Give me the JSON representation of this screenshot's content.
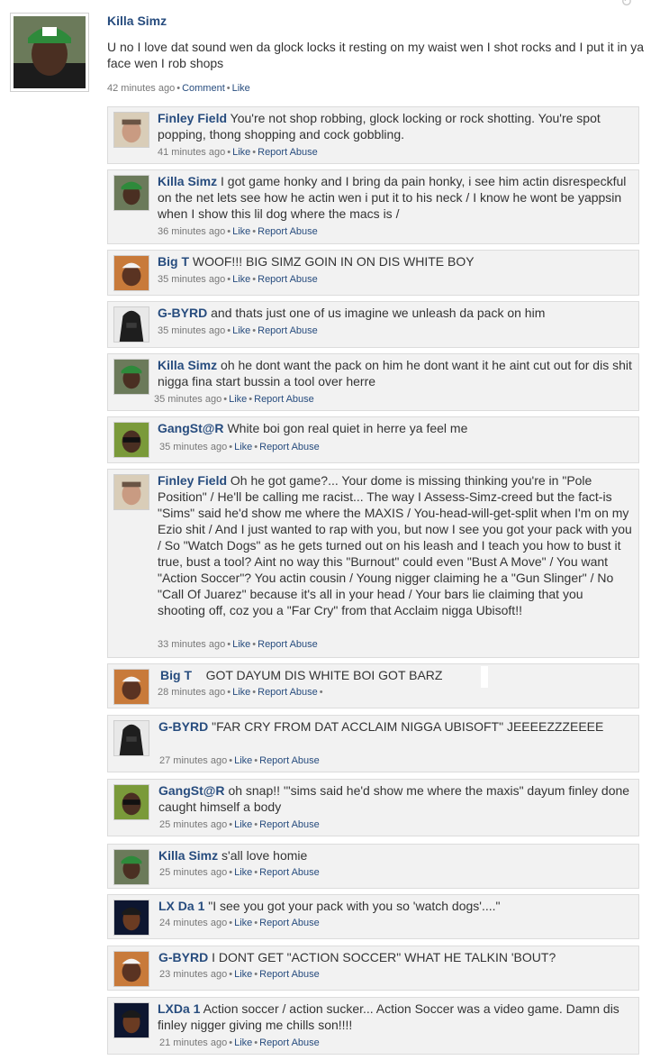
{
  "post": {
    "author": "Killa Simz",
    "text": "U no I love dat sound wen da glock locks  it resting on my waist wen I shot rocks and I put it in ya face wen I rob shops",
    "time": "42 minutes ago",
    "comment_label": "Comment",
    "like_label": "Like"
  },
  "actions": {
    "like": "Like",
    "report": "Report Abuse"
  },
  "comments": [
    {
      "author": "Finley Field",
      "avatar": "finley-avatar",
      "text": "You're not shop robbing, glock locking or rock shotting. You're spot popping, thong shopping and cock gobbling.",
      "time": "41 minutes ago"
    },
    {
      "author": "Killa Simz",
      "avatar": "killa-avatar",
      "text": "I got game honky and I bring da pain honky, i see him actin disrespeckful on the net lets see how he actin wen i put it to his neck / I know he wont be yappsin when I show this lil dog where the macs is /",
      "time": "36 minutes ago"
    },
    {
      "author": "Big T",
      "avatar": "bigt-avatar",
      "text": "WOOF!!! BIG SIMZ GOIN IN ON DIS WHITE BOY",
      "time": "35 minutes ago"
    },
    {
      "author": "G-BYRD",
      "avatar": "gbyrd-avatar",
      "text": "and thats just one of us imagine we unleash da pack on him",
      "time": "35 minutes ago"
    },
    {
      "author": "Killa Simz",
      "avatar": "killa-avatar",
      "text": "oh he dont want the pack on him he dont want it he aint cut out for dis shit nigga fina start bussin a tool over herre",
      "time": "35 minutes ago"
    },
    {
      "author": "GangSt@R",
      "avatar": "gangstar-avatar",
      "text": "White boi gon real quiet in herre ya feel me",
      "time": "35 minutes ago"
    },
    {
      "author": "Finley Field",
      "avatar": "finley-avatar",
      "text": "Oh he got game?... Your dome is missing thinking you're in \"Pole Position\" / He'll be calling me racist... The way I Assess-Simz-creed but the fact-is \"Sims\" said he'd show me where the MAXIS / You-head-will-get-split when I'm on my Ezio shit / And I just wanted to rap with you, but now I see you got your pack with you / So \"Watch Dogs\" as he gets turned out on his leash and I teach you how to bust it true, bust a tool? Aint no way this \"Burnout\" could even \"Bust A Move\" / You want \"Action Soccer\"? You actin cousin / Young nigger claiming he a \"Gun Slinger\" / No \"Call Of Juarez\" because it's all in your head / Your bars lie claiming that you shooting off, coz you a \"Far Cry\" from that Acclaim nigga Ubisoft!!",
      "time": "33 minutes ago"
    },
    {
      "author": "Big T",
      "avatar": "bigt-avatar",
      "text": "GOT DAYUM DIS WHITE BOI GOT BARZ",
      "time": "28 minutes ago"
    },
    {
      "author": "G-BYRD",
      "avatar": "gbyrd-avatar",
      "text": "\"FAR CRY FROM DAT ACCLAIM NIGGA UBISOFT\" JEEEEZZZEEEE",
      "time": "27 minutes ago"
    },
    {
      "author": "GangSt@R",
      "avatar": "gangstar-avatar",
      "text": "oh snap!! '\"sims said he'd show me where the maxis\" dayum finley done caught himself a body",
      "time": "25 minutes ago"
    },
    {
      "author": "Killa Simz",
      "avatar": "killa-avatar",
      "text": "s'all love homie",
      "time": "25 minutes ago"
    },
    {
      "author": "LX Da 1",
      "avatar": "lx-avatar",
      "text": "\"I see you got your pack with you so 'watch dogs'....\"",
      "time": "24 minutes ago"
    },
    {
      "author": "G-BYRD",
      "avatar": "bigt-avatar",
      "text": "I DONT GET \"ACTION SOCCER\" WHAT HE TALKIN 'BOUT?",
      "time": "23 minutes ago"
    },
    {
      "author": "LXDa 1",
      "avatar": "lx-avatar",
      "text": "Action soccer / action sucker... Action Soccer was a video game. Damn dis finley nigger giving me chills son!!!!",
      "time": "21 minutes ago"
    }
  ]
}
